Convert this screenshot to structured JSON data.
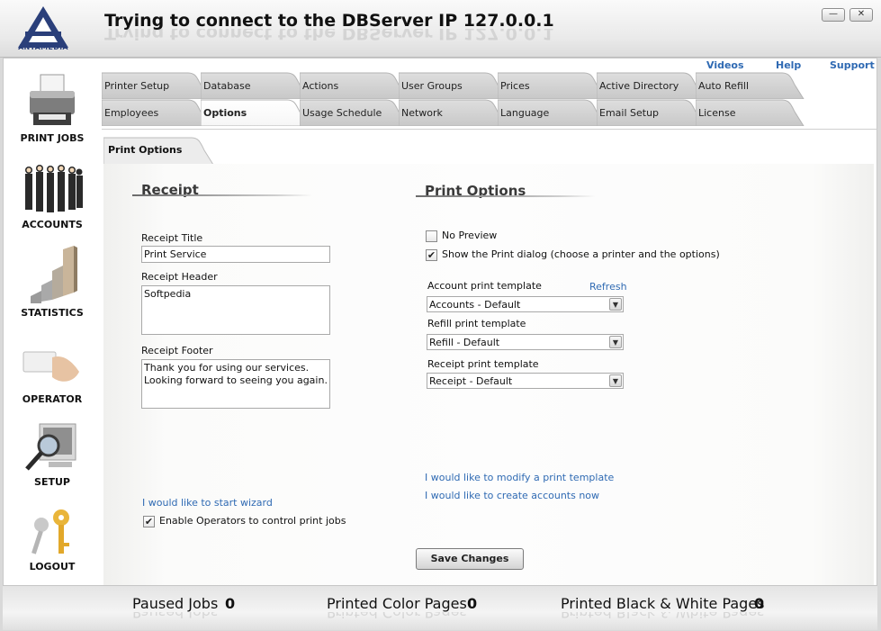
{
  "app": {
    "logo_text": "ANTAMEDIA",
    "title": "Trying to connect to the DBServer IP 127.0.0.1",
    "minimize_icon": "minimize-icon",
    "close_icon": "close-icon"
  },
  "sidebar": {
    "items": [
      {
        "label": "PRINT JOBS",
        "icon": "printer-icon"
      },
      {
        "label": "ACCOUNTS",
        "icon": "people-icon"
      },
      {
        "label": "STATISTICS",
        "icon": "bar-chart-icon"
      },
      {
        "label": "OPERATOR",
        "icon": "card-hand-icon"
      },
      {
        "label": "SETUP",
        "icon": "magnifier-monitor-icon"
      },
      {
        "label": "LOGOUT",
        "icon": "keys-icon"
      }
    ]
  },
  "top_links": {
    "videos": "Videos",
    "help": "Help",
    "support": "Support"
  },
  "tabs": {
    "row1": [
      "Printer Setup",
      "Database",
      "Actions",
      "User Groups",
      "Prices",
      "Active Directory",
      "Auto Refill"
    ],
    "row2": [
      "Employees",
      "Options",
      "Usage Schedule",
      "Network",
      "Language",
      "Email Setup",
      "License"
    ],
    "active": "Options"
  },
  "subtab": {
    "label": "Print Options"
  },
  "receipt": {
    "section_title": "Receipt",
    "title_label": "Receipt Title",
    "title_value": "Print Service",
    "header_label": "Receipt Header",
    "header_value": "Softpedia",
    "footer_label": "Receipt Footer",
    "footer_value": "Thank you for using our services.\nLooking forward to seeing you again.",
    "wizard_link": "I would like to start wizard",
    "enable_operators_label": "Enable Operators to control print jobs",
    "enable_operators_checked": true
  },
  "print_options": {
    "section_title": "Print Options",
    "no_preview_label": "No Preview",
    "no_preview_checked": false,
    "show_dialog_label": "Show the Print dialog (choose a printer and the options)",
    "show_dialog_checked": true,
    "account_template_label": "Account print template",
    "refresh_link": "Refresh",
    "account_template_value": "Accounts - Default",
    "refill_template_label": "Refill print template",
    "refill_template_value": "Refill - Default",
    "receipt_template_label": "Receipt print template",
    "receipt_template_value": "Receipt - Default",
    "modify_template_link": "I would like to modify a print template",
    "create_accounts_link": "I would like to create accounts now"
  },
  "save_button": "Save Changes",
  "status": {
    "paused_label": "Paused Jobs",
    "paused_value": "0",
    "color_label": "Printed Color Pages",
    "color_value": "0",
    "bw_label": "Printed Black & White Pages",
    "bw_value": "0"
  }
}
